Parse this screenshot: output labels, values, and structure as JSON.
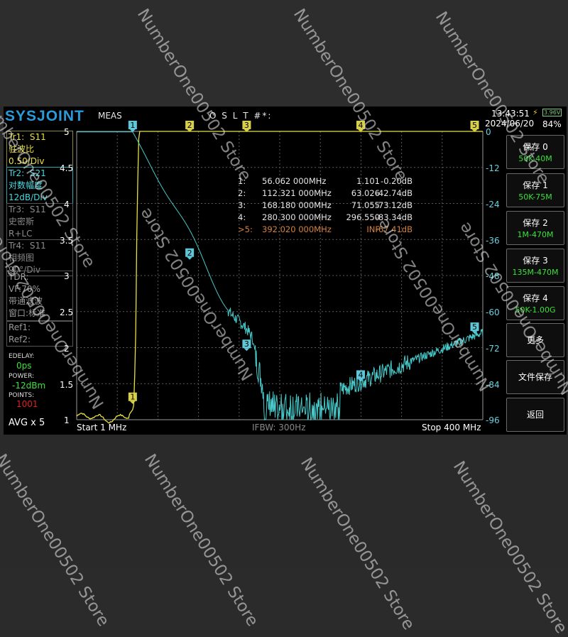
{
  "header": {
    "logo": "SYSJOINT",
    "meas": "MEAS",
    "cal": "O S L T #*:",
    "time": "13:43:51",
    "date": "2024/06/20",
    "voltage": "3.96V",
    "battery": "84%"
  },
  "traces": [
    {
      "name": "Tr1:",
      "param": "S11",
      "format": "驻波比",
      "scale": "0.50/Div"
    },
    {
      "name": "Tr2:",
      "param": "S21",
      "format": "对数幅度",
      "scale": "12dB/Div"
    },
    {
      "name": "Tr3:",
      "param": "S11",
      "format": "史密斯",
      "scale": "R+LC"
    },
    {
      "name": "Tr4:",
      "param": "S11",
      "format": "相频图",
      "scale": "90°/Div"
    }
  ],
  "tdr": {
    "title": "TDR:",
    "vf": "VF:70%",
    "mode": "带通滤波",
    "window": "窗口:标准"
  },
  "refs": {
    "ref1": "Ref1:",
    "ref2": "Ref2:"
  },
  "params": {
    "edelay_label": "EDELAY:",
    "edelay_value": "0ps",
    "power_label": "POWER:",
    "power_value": "-12dBm",
    "points_label": "POINTS:",
    "points_value": "1001",
    "avg": "AVG x 5"
  },
  "axes": {
    "left_ticks": [
      "5",
      "4.5",
      "4",
      "3.5",
      "3",
      "2.5",
      "2",
      "1.5",
      "1"
    ],
    "right_ticks": [
      "0",
      "-12",
      "-24",
      "-36",
      "-48",
      "-60",
      "-72",
      "-84",
      "-96"
    ],
    "start": "Start   1 MHz",
    "ifbw": "IFBW: 300Hz",
    "stop": "Stop   400 MHz"
  },
  "markers": [
    {
      "idx": "1:",
      "freq": "56.062 000MHz",
      "swr": "1.101",
      "db": "-0.20dB",
      "active": false
    },
    {
      "idx": "2:",
      "freq": "112.321 000MHz",
      "swr": "63.026",
      "db": "-42.74dB",
      "active": false
    },
    {
      "idx": "3:",
      "freq": "168.180 000MHz",
      "swr": "71.055",
      "db": "-73.12dB",
      "active": false
    },
    {
      "idx": "4:",
      "freq": "280.300 000MHz",
      "swr": "296.550",
      "db": "-83.34dB",
      "active": false
    },
    {
      "idx": ">5:",
      "freq": "392.020 000MHz",
      "swr": "INF",
      "db": "-67.41dB",
      "active": true
    }
  ],
  "marker_flags": [
    "1",
    "2",
    "3",
    "4",
    "5"
  ],
  "buttons": [
    {
      "title": "保存 0",
      "sub": "50K-40M"
    },
    {
      "title": "保存 1",
      "sub": "50K-75M"
    },
    {
      "title": "保存 2",
      "sub": "1M-470M"
    },
    {
      "title": "保存 3",
      "sub": "135M-470M"
    },
    {
      "title": "保存 4",
      "sub": "50K-1.00G"
    },
    {
      "title": "更多",
      "sub": ""
    },
    {
      "title": "文件保存",
      "sub": ""
    },
    {
      "title": "返回",
      "sub": ""
    }
  ],
  "colors": {
    "tr1": "#e8e043",
    "tr2": "#48c8c8",
    "marker_active": "#d4823a",
    "accent_green": "#3ce03c"
  },
  "watermark": "NumberOne00502 Store"
}
